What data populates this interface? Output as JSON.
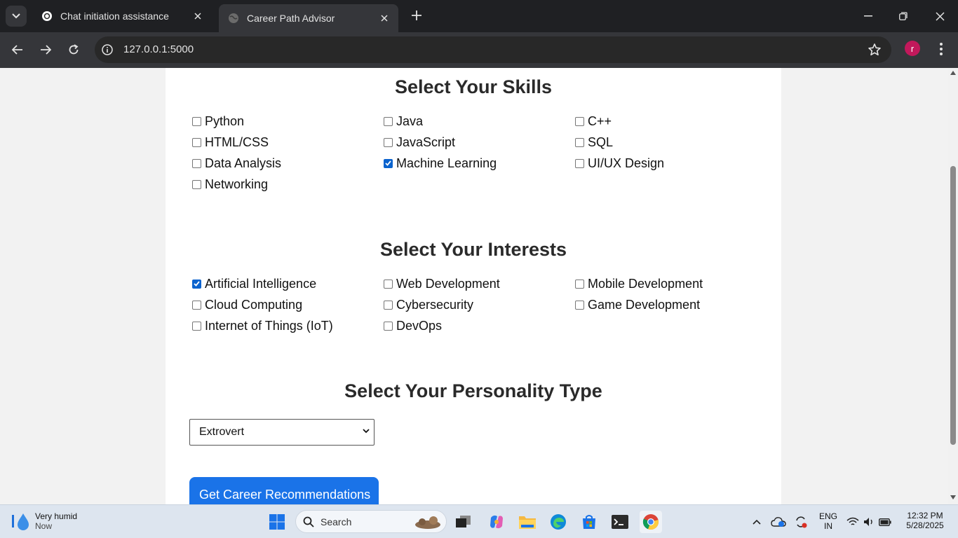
{
  "browser": {
    "tabs": [
      {
        "title": "Chat initiation assistance",
        "active": false
      },
      {
        "title": "Career Path Advisor",
        "active": true
      }
    ],
    "url": "127.0.0.1:5000",
    "profile_initial": "r"
  },
  "page": {
    "skills": {
      "title": "Select Your Skills",
      "options": [
        {
          "label": "Python",
          "checked": false
        },
        {
          "label": "Java",
          "checked": false
        },
        {
          "label": "C++",
          "checked": false
        },
        {
          "label": "HTML/CSS",
          "checked": false
        },
        {
          "label": "JavaScript",
          "checked": false
        },
        {
          "label": "SQL",
          "checked": false
        },
        {
          "label": "Data Analysis",
          "checked": false
        },
        {
          "label": "Machine Learning",
          "checked": true
        },
        {
          "label": "UI/UX Design",
          "checked": false
        },
        {
          "label": "Networking",
          "checked": false
        }
      ]
    },
    "interests": {
      "title": "Select Your Interests",
      "options": [
        {
          "label": "Artificial Intelligence",
          "checked": true
        },
        {
          "label": "Web Development",
          "checked": false
        },
        {
          "label": "Mobile Development",
          "checked": false
        },
        {
          "label": "Cloud Computing",
          "checked": false
        },
        {
          "label": "Cybersecurity",
          "checked": false
        },
        {
          "label": "Game Development",
          "checked": false
        },
        {
          "label": "Internet of Things (IoT)",
          "checked": false
        },
        {
          "label": "DevOps",
          "checked": false
        }
      ]
    },
    "personality": {
      "title": "Select Your Personality Type",
      "selected": "Extrovert"
    },
    "submit_label": "Get Career Recommendations"
  },
  "taskbar": {
    "weather_title": "Very humid",
    "weather_sub": "Now",
    "search_label": "Search",
    "lang_1": "ENG",
    "lang_2": "IN",
    "time": "12:32 PM",
    "date": "5/28/2025"
  },
  "colors": {
    "checkbox_checked": "#0b63ce",
    "cta": "#1a73e8",
    "avatar": "#c2185b"
  }
}
